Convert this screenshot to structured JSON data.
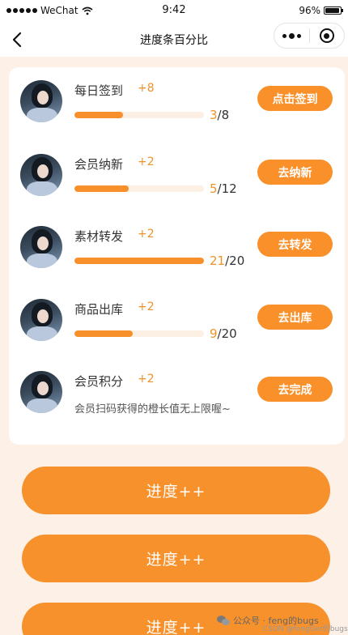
{
  "status_bar": {
    "carrier": "WeChat",
    "time": "9:42",
    "battery": "96%",
    "battery_level": 0.96
  },
  "nav": {
    "title": "进度条百分比"
  },
  "tasks": [
    {
      "name": "每日签到",
      "points": "+8",
      "done": "3",
      "total": "/8",
      "progress": 0.375,
      "action": "点击签到"
    },
    {
      "name": "会员纳新",
      "points": "+2",
      "done": "5",
      "total": "/12",
      "progress": 0.4167,
      "action": "去纳新"
    },
    {
      "name": "素材转发",
      "points": "+2",
      "done": "21",
      "total": "/20",
      "progress": 1.0,
      "action": "去转发"
    },
    {
      "name": "商品出库",
      "points": "+2",
      "done": "9",
      "total": "/20",
      "progress": 0.45,
      "action": "去出库"
    },
    {
      "name": "会员积分",
      "points": "+2",
      "description": "会员扫码获得的橙长值无上限喔~",
      "action": "去完成"
    }
  ],
  "buttons": [
    {
      "label": "进度++"
    },
    {
      "label": "进度++"
    },
    {
      "label": "进度++"
    }
  ],
  "watermark": {
    "text": "公众号 · feng的bugs",
    "csdn": "CSDN @fengGer的bugs"
  },
  "colors": {
    "accent": "#f7902a",
    "page_bg": "#fdf0e6",
    "track": "#fcefe3"
  }
}
